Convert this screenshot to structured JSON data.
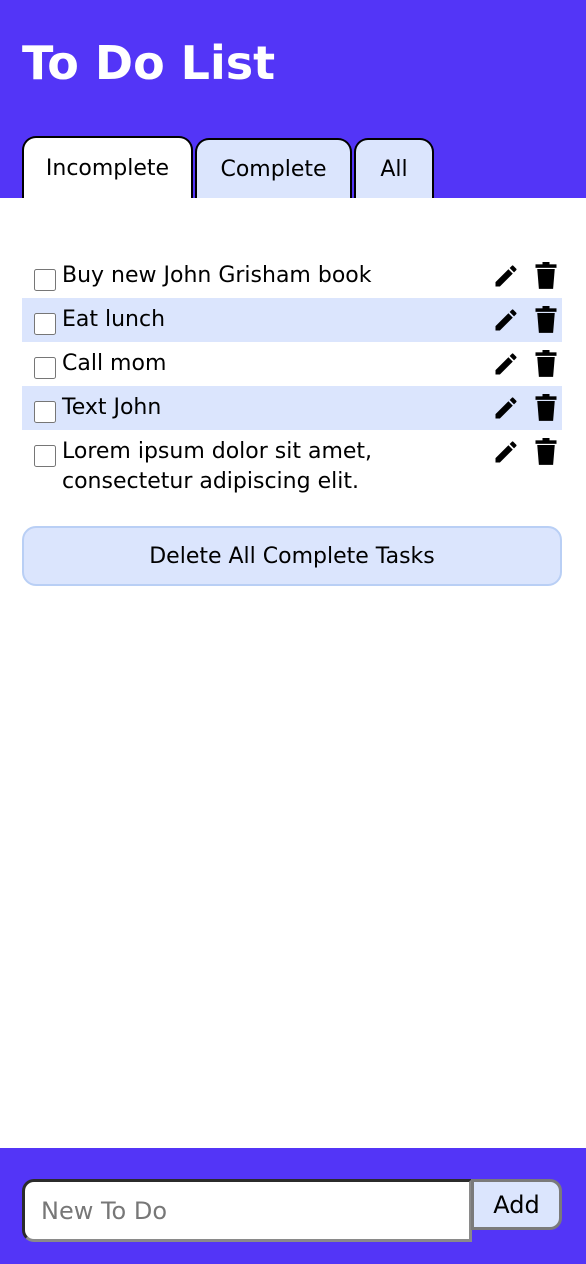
{
  "app": {
    "title": "To Do List"
  },
  "tabs": [
    {
      "label": "Incomplete",
      "active": true
    },
    {
      "label": "Complete",
      "active": false
    },
    {
      "label": "All",
      "active": false
    }
  ],
  "tasks": [
    {
      "text": "Buy new John Grisham book",
      "checked": false
    },
    {
      "text": "Eat lunch",
      "checked": false
    },
    {
      "text": "Call mom",
      "checked": false
    },
    {
      "text": "Text John",
      "checked": false
    },
    {
      "text": "Lorem ipsum dolor sit amet, consectetur adipiscing elit.",
      "checked": false
    }
  ],
  "actions": {
    "delete_all_label": "Delete All Complete Tasks"
  },
  "footer": {
    "input_placeholder": "New To Do",
    "input_value": "",
    "add_label": "Add"
  },
  "colors": {
    "brand": "#5335f7",
    "row_alt": "#dbe5fd",
    "button_bg": "#dbe5fd"
  },
  "icons": {
    "edit": "pencil-icon",
    "delete": "trash-icon"
  }
}
